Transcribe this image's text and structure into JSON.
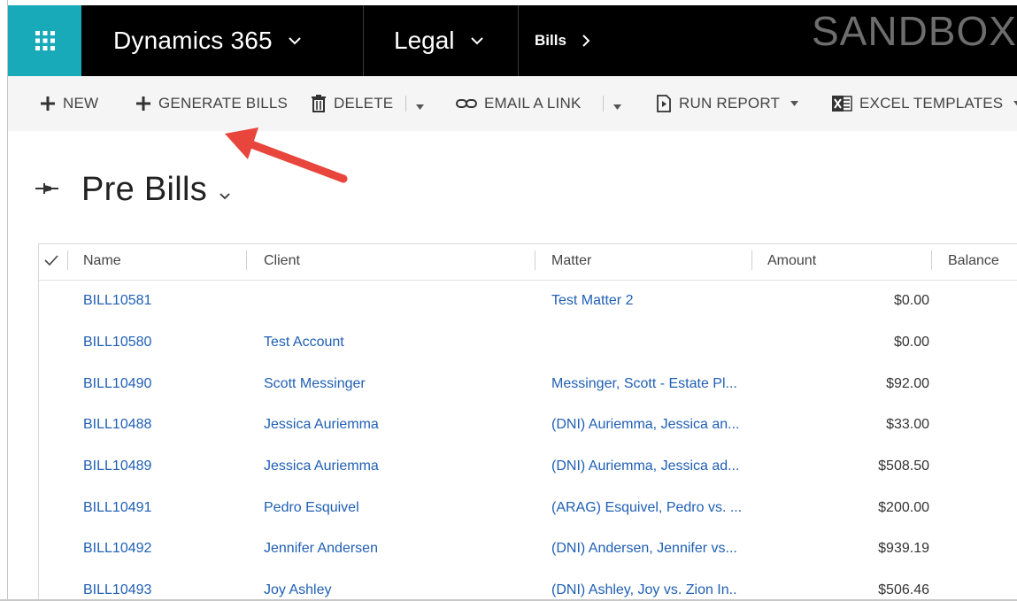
{
  "nav": {
    "app_title": "Dynamics 365",
    "module": "Legal",
    "area": "Bills",
    "environment": "SANDBOX",
    "waffle_color": "#18aab8"
  },
  "commands": {
    "new": "NEW",
    "generate_bills": "GENERATE BILLS",
    "delete": "DELETE",
    "email_link": "EMAIL A LINK",
    "run_report": "RUN REPORT",
    "excel_templates": "EXCEL TEMPLATES"
  },
  "view": {
    "title": "Pre Bills"
  },
  "grid": {
    "columns": [
      "Name",
      "Client",
      "Matter",
      "Amount",
      "Balance"
    ],
    "rows": [
      {
        "name": "BILL10581",
        "client": "",
        "matter": "Test Matter 2",
        "amount": "$0.00"
      },
      {
        "name": "BILL10580",
        "client": "Test Account",
        "matter": "",
        "amount": "$0.00"
      },
      {
        "name": "BILL10490",
        "client": "Scott Messinger",
        "matter": "Messinger, Scott - Estate Pl...",
        "amount": "$92.00"
      },
      {
        "name": "BILL10488",
        "client": "Jessica Auriemma",
        "matter": "(DNI) Auriemma, Jessica an...",
        "amount": "$33.00"
      },
      {
        "name": "BILL10489",
        "client": "Jessica Auriemma",
        "matter": "(DNI) Auriemma, Jessica ad...",
        "amount": "$508.50"
      },
      {
        "name": "BILL10491",
        "client": "Pedro Esquivel",
        "matter": "(ARAG) Esquivel, Pedro vs. ...",
        "amount": "$200.00"
      },
      {
        "name": "BILL10492",
        "client": "Jennifer Andersen",
        "matter": "(DNI) Andersen, Jennifer vs...",
        "amount": "$939.19"
      },
      {
        "name": "BILL10493",
        "client": "Joy Ashley",
        "matter": "(DNI) Ashley, Joy vs. Zion In..",
        "amount": "$506.46"
      }
    ]
  },
  "colors": {
    "link": "#1f5fb4",
    "annotation_arrow": "#e8453c"
  }
}
